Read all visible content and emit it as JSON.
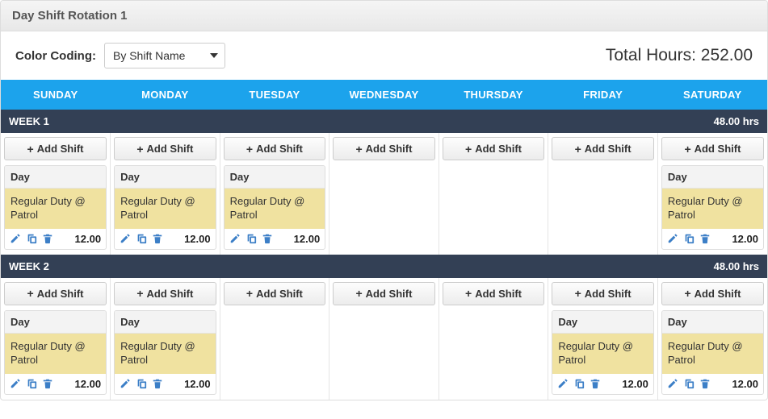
{
  "header": {
    "title": "Day Shift Rotation 1"
  },
  "controls": {
    "colorCodingLabel": "Color Coding:",
    "colorCodingValue": "By Shift Name",
    "totalHoursLabel": "Total Hours:",
    "totalHoursValue": "252.00"
  },
  "days": [
    "SUNDAY",
    "MONDAY",
    "TUESDAY",
    "WEDNESDAY",
    "THURSDAY",
    "FRIDAY",
    "SATURDAY"
  ],
  "addShiftLabel": "Add Shift",
  "shiftTemplate": {
    "name": "Day",
    "desc": "Regular Duty @ Patrol",
    "hours": "12.00"
  },
  "weeks": [
    {
      "label": "WEEK 1",
      "hours": "48.00 hrs",
      "cells": [
        {
          "shift": true
        },
        {
          "shift": true
        },
        {
          "shift": true
        },
        {
          "shift": false
        },
        {
          "shift": false
        },
        {
          "shift": false
        },
        {
          "shift": true
        }
      ]
    },
    {
      "label": "WEEK 2",
      "hours": "48.00 hrs",
      "cells": [
        {
          "shift": true
        },
        {
          "shift": true
        },
        {
          "shift": false
        },
        {
          "shift": false
        },
        {
          "shift": false
        },
        {
          "shift": true
        },
        {
          "shift": true
        }
      ]
    }
  ]
}
